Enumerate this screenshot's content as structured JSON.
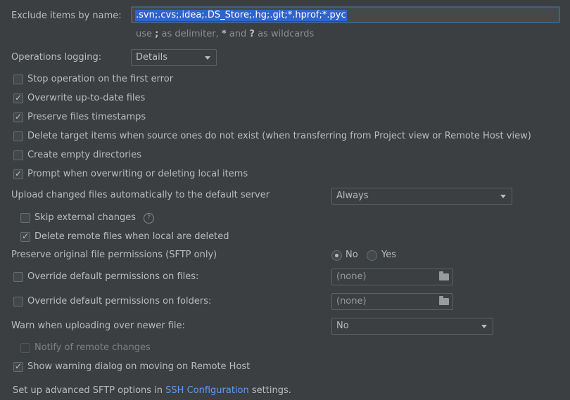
{
  "exclude": {
    "label": "Exclude items by name:",
    "value": ".svn;.cvs;.idea;.DS_Store;.hg;.git;*.hprof;*.pyc",
    "hint_prefix": "use",
    "hint_delimiter": ";",
    "hint_middle": "as delimiter,",
    "hint_star": "*",
    "hint_and": "and",
    "hint_q": "?",
    "hint_suffix": "as wildcards"
  },
  "ops_logging": {
    "label": "Operations logging:",
    "value": "Details"
  },
  "checkboxes": {
    "stop_first_error": {
      "label": "Stop operation on the first error",
      "checked": false
    },
    "overwrite_up_to_date": {
      "label": "Overwrite up-to-date files",
      "checked": true
    },
    "preserve_timestamps": {
      "label": "Preserve files timestamps",
      "checked": true
    },
    "delete_target": {
      "label": "Delete target items when source ones do not exist (when transferring from Project view or Remote Host view)",
      "checked": false
    },
    "create_empty_dirs": {
      "label": "Create empty directories",
      "checked": false
    },
    "prompt_overwriting": {
      "label": "Prompt when overwriting or deleting local items",
      "checked": true
    },
    "skip_external": {
      "label": "Skip external changes",
      "checked": false
    },
    "delete_remote": {
      "label": "Delete remote files when local are deleted",
      "checked": true
    },
    "override_files": {
      "label": "Override default permissions on files:",
      "checked": false
    },
    "override_folders": {
      "label": "Override default permissions on folders:",
      "checked": false
    },
    "notify_remote": {
      "label": "Notify of remote changes",
      "checked": false
    },
    "show_warning": {
      "label": "Show warning dialog on moving on Remote Host",
      "checked": true
    }
  },
  "check_mark": "✓",
  "help_mark": "?",
  "upload": {
    "label": "Upload changed files automatically to the default server",
    "value": "Always"
  },
  "permissions": {
    "label": "Preserve original file permissions (SFTP only)",
    "no_label": "No",
    "yes_label": "Yes",
    "selected": "No"
  },
  "files_perm": {
    "value": "(none)"
  },
  "folders_perm": {
    "value": "(none)"
  },
  "warn_newer": {
    "label": "Warn when uploading over newer file:",
    "value": "No"
  },
  "footer": {
    "prefix": "Set up advanced SFTP options in",
    "link": "SSH Configuration",
    "suffix": "settings."
  },
  "colors": {
    "background": "#3c3f41",
    "text": "#bbbbbb",
    "selection": "#2f65ca",
    "focus_border": "#3d6185",
    "link": "#589df6"
  }
}
